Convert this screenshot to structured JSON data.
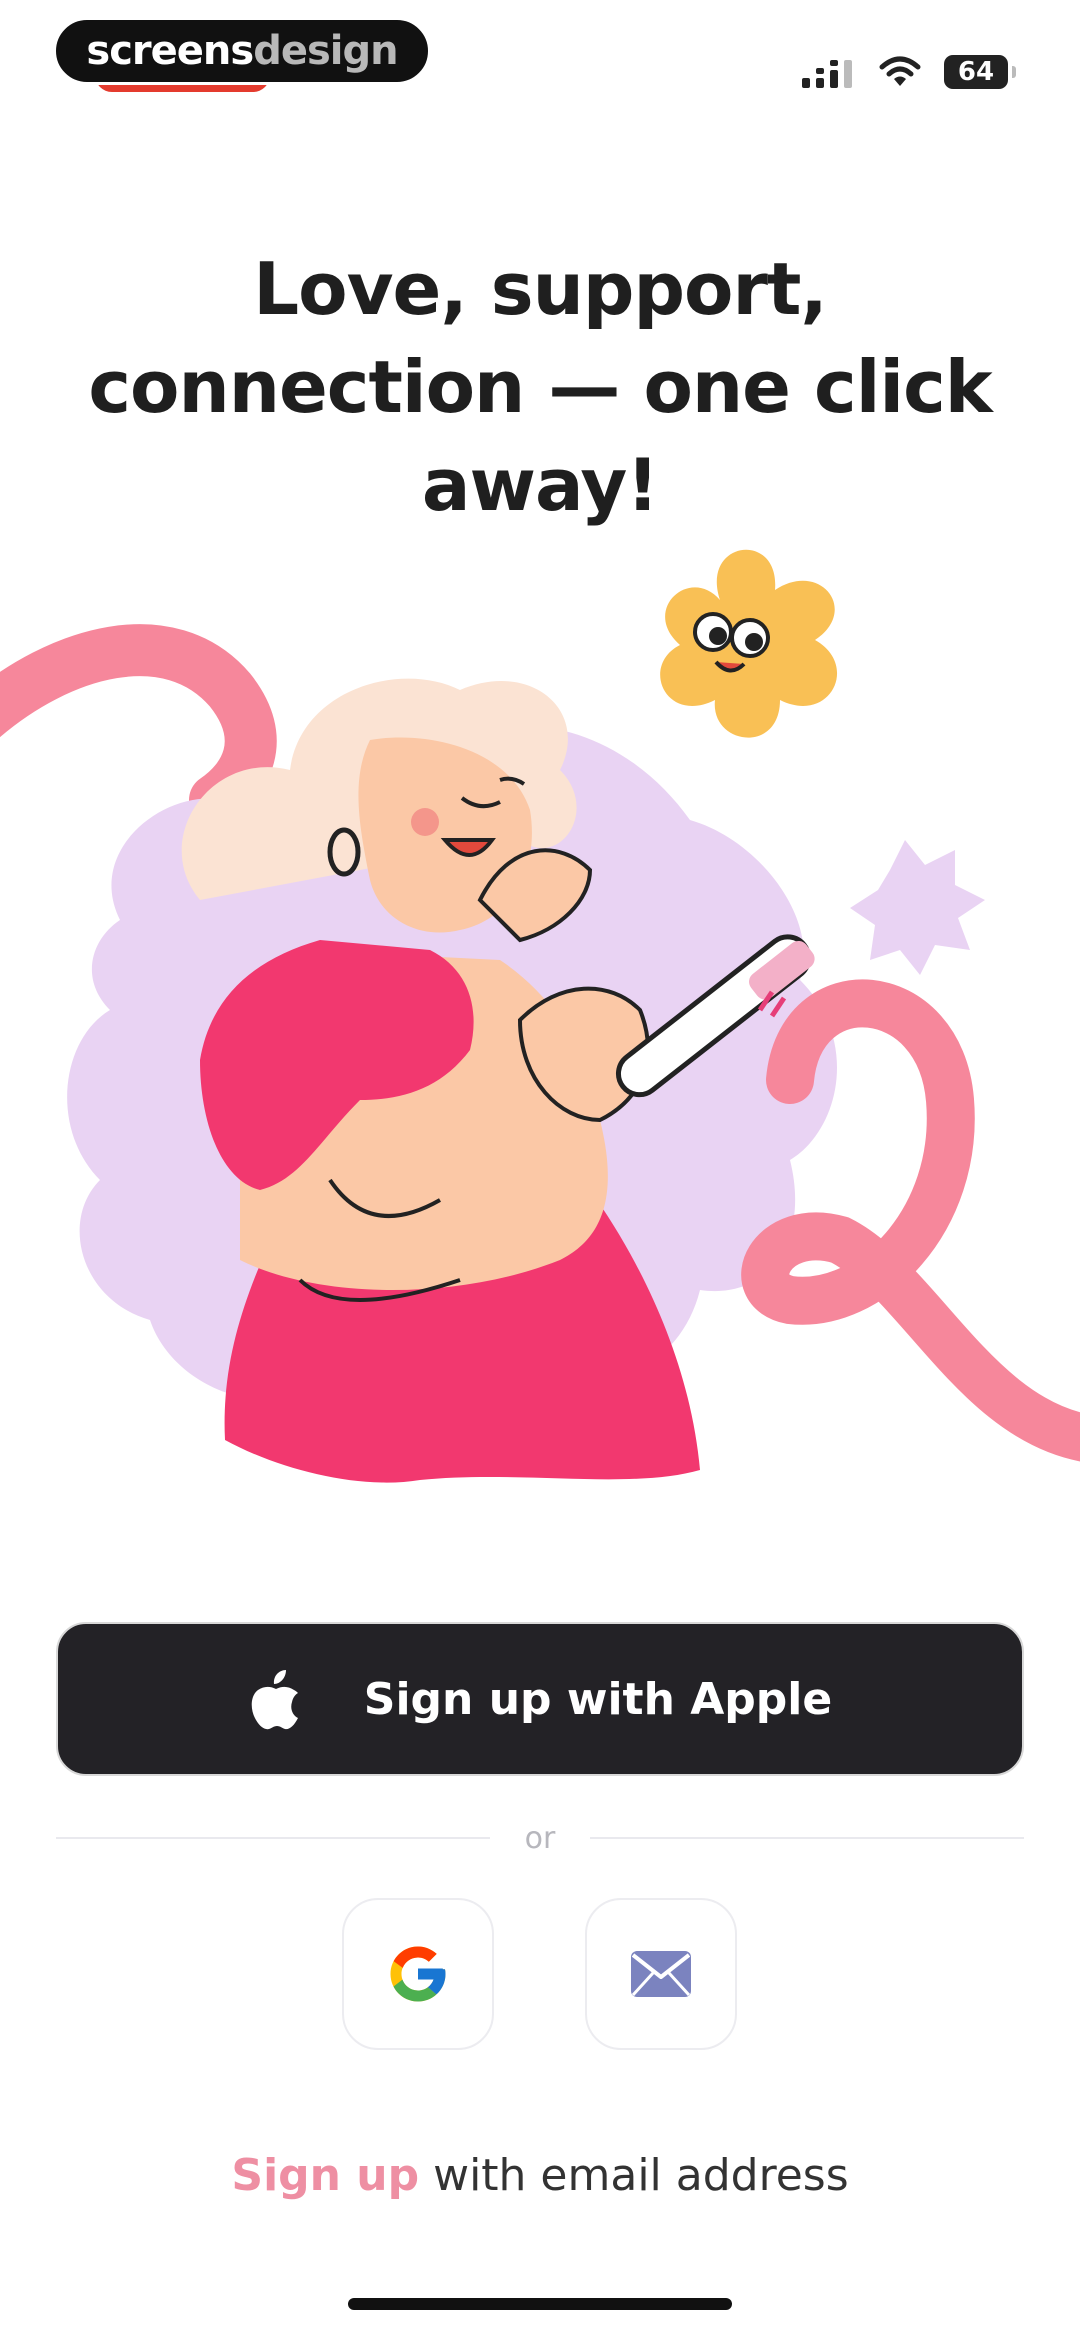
{
  "status_bar": {
    "brand_part1": "screens",
    "brand_part2": "design",
    "battery": "64"
  },
  "headline": {
    "line1": "Love, support,",
    "line2": "connection — one click",
    "line3": "away!"
  },
  "apple_button": {
    "label": "Sign up with Apple"
  },
  "divider": {
    "label": "or"
  },
  "social": [
    {
      "name": "google",
      "icon": "google-icon"
    },
    {
      "name": "email",
      "icon": "mail-icon"
    }
  ],
  "email_link": {
    "signup": "Sign up",
    "rest": " with email address"
  },
  "colors": {
    "accent_pink": "#ee8fa3",
    "button_dark": "#232226",
    "illustration_pink": "#f2386f",
    "illustration_lilac": "#e9d3f3",
    "ribbon_pink": "#f6879b",
    "flower_yellow": "#f9c055"
  }
}
